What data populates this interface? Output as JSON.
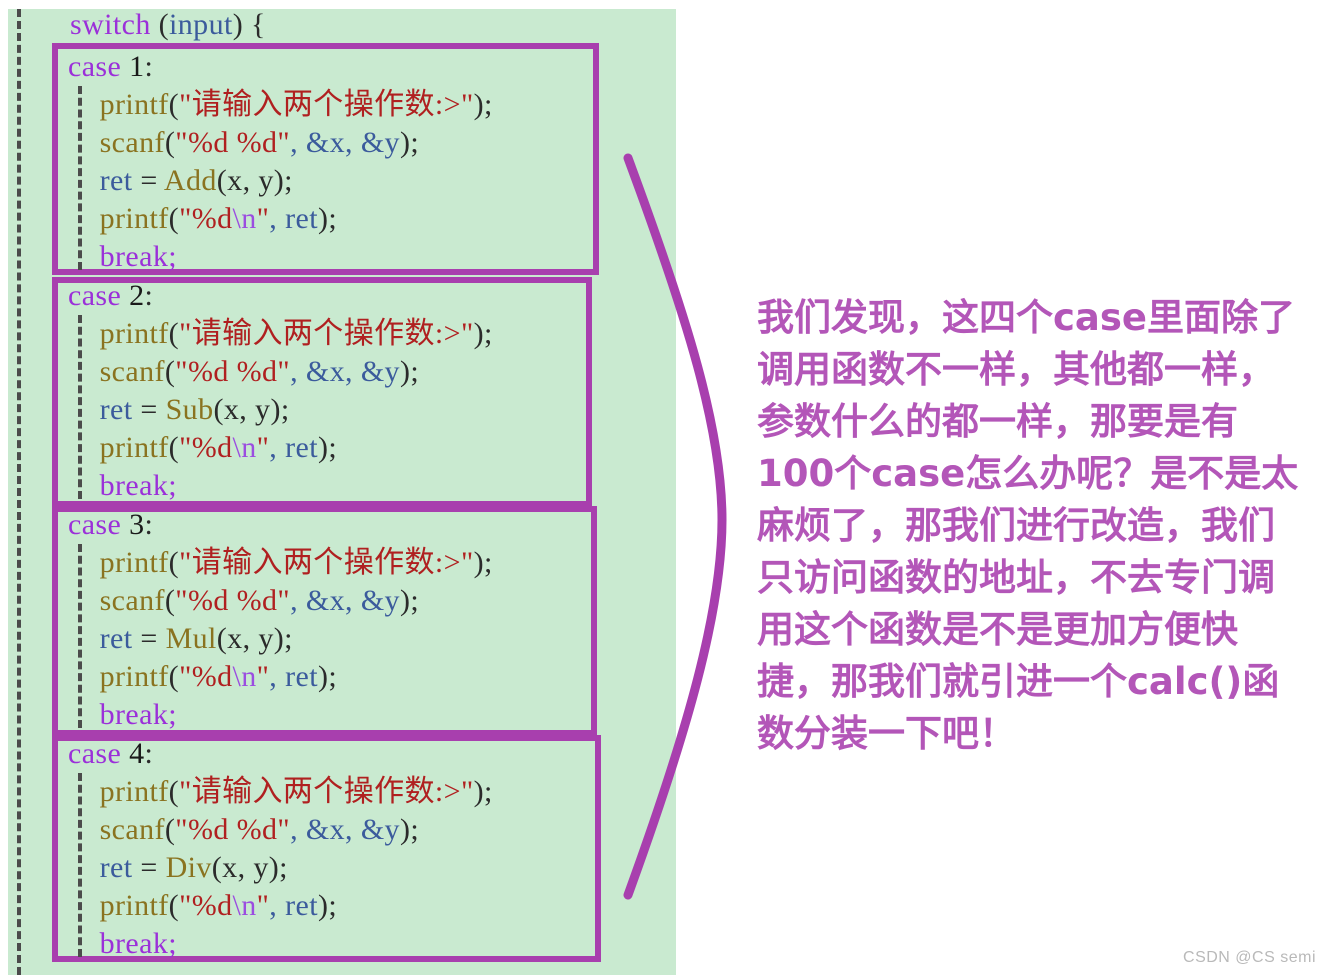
{
  "canvas": {
    "background_color": "#c9ead0",
    "page_background": "#ffffff"
  },
  "colors": {
    "box_border": "#a83fae",
    "brace_curve": "#a83fae",
    "annotation_text": "#b356b8",
    "keyword": "#9b30d9",
    "function": "#8a7320",
    "string": "#b02020",
    "escape": "#9b4de0",
    "variable": "#3b5b9c",
    "punctuation": "#2b2b2b",
    "indent_guide": "#4b4b4b",
    "watermark": "#b9b9b9"
  },
  "code": {
    "switch_line": {
      "keyword": "switch",
      "open_paren": " (",
      "variable": "input",
      "close_paren": ") ",
      "brace": "{"
    },
    "shared_lines": {
      "printf_prompt": {
        "fn": "printf",
        "open": "(",
        "string": "\"请输入两个操作数:>\"",
        "close": ");"
      },
      "scanf_line": {
        "fn": "scanf",
        "open": "(",
        "string": "\"%d %d\"",
        "args": ", &x, &y",
        "close": ");"
      },
      "printf_result": {
        "fn": "printf",
        "open": "(",
        "string_a": "\"%d",
        "escape": "\\n",
        "string_b": "\"",
        "args": ", ret",
        "close": ");"
      },
      "break_line": "break;",
      "assign_prefix": "ret",
      "assign_op": " = ",
      "assign_args": "(x, y);"
    },
    "cases": [
      {
        "label": "case",
        "number": "1",
        "function": "Add"
      },
      {
        "label": "case",
        "number": "2",
        "function": "Sub"
      },
      {
        "label": "case",
        "number": "3",
        "function": "Mul"
      },
      {
        "label": "case",
        "number": "4",
        "function": "Div"
      }
    ]
  },
  "annotation": {
    "text": "我们发现，这四个case里面除了调用函数不一样，其他都一样，参数什么的都一样，那要是有100个case怎么办呢？是不是太麻烦了，那我们进行改造，我们只访问函数的地址，不去专门调用这个函数是不是更加方便快捷，那我们就引进一个calc()函数分装一下吧！"
  },
  "watermark": {
    "text": "CSDN @CS semi"
  }
}
